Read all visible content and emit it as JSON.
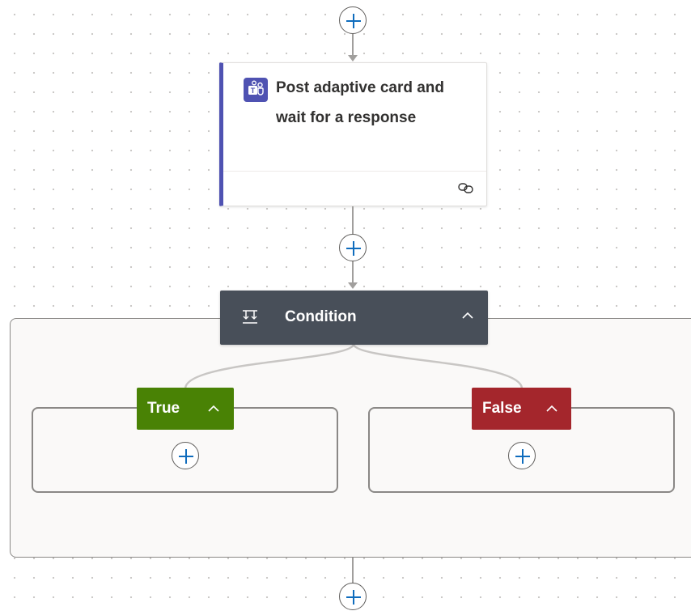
{
  "top_add_button": {
    "icon": "plus-icon"
  },
  "action_card": {
    "title": "Post adaptive card and wait for a response",
    "icon": "teams-icon",
    "accent_color": "#4f52b2",
    "footer_icon": "link-icon"
  },
  "middle_add_button": {
    "icon": "plus-icon"
  },
  "condition": {
    "title": "Condition",
    "icon": "condition-icon",
    "header_color": "#484f59",
    "toggle_icon": "chevron-up-icon"
  },
  "branches": {
    "true": {
      "label": "True",
      "color": "#498205",
      "toggle_icon": "chevron-up-icon"
    },
    "false": {
      "label": "False",
      "color": "#a4262c",
      "toggle_icon": "chevron-up-icon"
    }
  },
  "bottom_add_button": {
    "icon": "plus-icon"
  }
}
